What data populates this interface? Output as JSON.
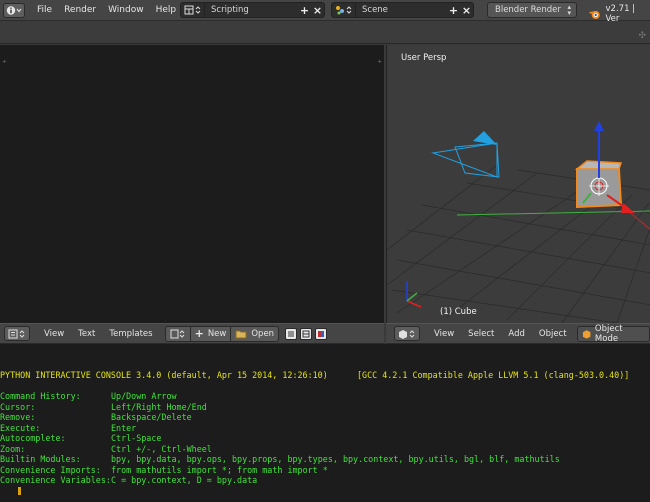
{
  "topbar": {
    "menus": [
      "File",
      "Render",
      "Window",
      "Help"
    ],
    "screen_layout": "Scripting",
    "scene": "Scene",
    "render_engine": "Blender Render",
    "version": "v2.71 | Ver"
  },
  "text_editor": {
    "menus": [
      "View",
      "Text",
      "Templates"
    ],
    "new_label": "New",
    "open_label": "Open"
  },
  "viewport": {
    "view_label": "User Persp",
    "object_label": "(1) Cube",
    "menus": [
      "View",
      "Select",
      "Add",
      "Object"
    ],
    "mode": "Object Mode"
  },
  "console": {
    "header": "PYTHON INTERACTIVE CONSOLE 3.4.0 (default, Apr 15 2014, 12:26:10)",
    "gcc": "[GCC 4.2.1 Compatible Apple LLVM 5.1 (clang-503.0.40)]",
    "rows": [
      {
        "key": "Command History:",
        "value": "Up/Down Arrow"
      },
      {
        "key": "Cursor:",
        "value": "Left/Right Home/End"
      },
      {
        "key": "Remove:",
        "value": "Backspace/Delete"
      },
      {
        "key": "Execute:",
        "value": "Enter"
      },
      {
        "key": "Autocomplete:",
        "value": "Ctrl-Space"
      },
      {
        "key": "Zoom:",
        "value": "Ctrl +/-, Ctrl-Wheel"
      },
      {
        "key": "Builtin Modules:",
        "value": "bpy, bpy.data, bpy.ops, bpy.props, bpy.types, bpy.context, bpy.utils, bgl, blf, mathutils"
      },
      {
        "key": "Convenience Imports:",
        "value": "from mathutils import *; from math import *"
      },
      {
        "key": "Convenience Variables:",
        "value": "C = bpy.context, D = bpy.data"
      }
    ]
  },
  "colors": {
    "console_header": "#e3e318",
    "console_text": "#3fe33b",
    "camera": "#22a0e0",
    "cube_outline": "#f08a1f",
    "x_axis": "#e02020",
    "y_axis": "#40b040",
    "z_axis": "#2040e0"
  },
  "icons": [
    "info-editor-icon",
    "screen-layout-icon",
    "scene-icon",
    "blender-logo-icon",
    "text-editor-icon",
    "new-icon",
    "open-folder-icon",
    "view3d-editor-icon",
    "object-mode-icon"
  ]
}
